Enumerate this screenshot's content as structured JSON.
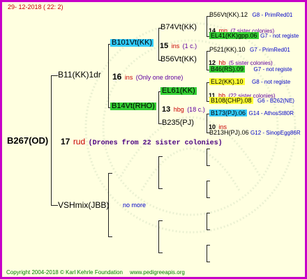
{
  "header": {
    "date": "29- 12-2018 ( 22:  2)"
  },
  "root": {
    "name": "B267(OD)",
    "num": "17",
    "unit": "rud",
    "note": "(Drones from 22 sister colonies)"
  },
  "sire": {
    "name": "B11(KK)1dr",
    "num": "16",
    "unit": "ins",
    "note": "(Only one drone)"
  },
  "dam": {
    "name": "VSHmix(JBB)",
    "note": "no more"
  },
  "ss": {
    "name": "B101Vt(KK)",
    "num": "15",
    "unit": "ins",
    "note": "(1 c.)"
  },
  "sd": {
    "name": "B14Vt(RHO)",
    "num": "13",
    "unit": "hbg",
    "note": "(18 c.)"
  },
  "sss": {
    "name": "B74Vt(KK)",
    "num": "14",
    "unit": "mn",
    "note": "(7 sister colonies)"
  },
  "ssd": {
    "name": "B56Vt(KK)",
    "num": "12",
    "unit": "hb",
    "note": "(5 sister colonies)"
  },
  "sds": {
    "name": "EL61(KK)",
    "num": "11",
    "unit": "hb",
    "note": "(22 sister colonies)"
  },
  "sdd": {
    "name": "B235(PJ)",
    "num": "10",
    "unit": "ins"
  },
  "g4": [
    {
      "name": "B56Vt(KK).12",
      "info": "G8 - PrimRed01"
    },
    {
      "name": "EL41(KK)gpp.06",
      "info": "G7 - not registe"
    },
    {
      "name": "P521(KK).10",
      "info": "G7 - PrimRed01"
    },
    {
      "name": "B46(RS).09",
      "info": "G7 - not registe"
    },
    {
      "name": "EL2(KK).10",
      "info": "G8 - not registe"
    },
    {
      "name": "B108(CHP).08",
      "info": "G6 - B262(NE)"
    },
    {
      "name": "B173(PJ).06",
      "info": "G14 - AthosSt80R"
    },
    {
      "name": "B213H(PJ).06",
      "info": "G12 - SinopEgg86R"
    }
  ],
  "footer": {
    "copyright": "Copyright 2004-2018 © Karl Kehrle Foundation",
    "url": "www.pedigreeapis.org"
  },
  "colors": {
    "border": "#c800c8",
    "background": "#ffffe0",
    "cyan_box": "#33ccff",
    "green_box": "#33cc33",
    "yellow_box": "#ffff33"
  }
}
